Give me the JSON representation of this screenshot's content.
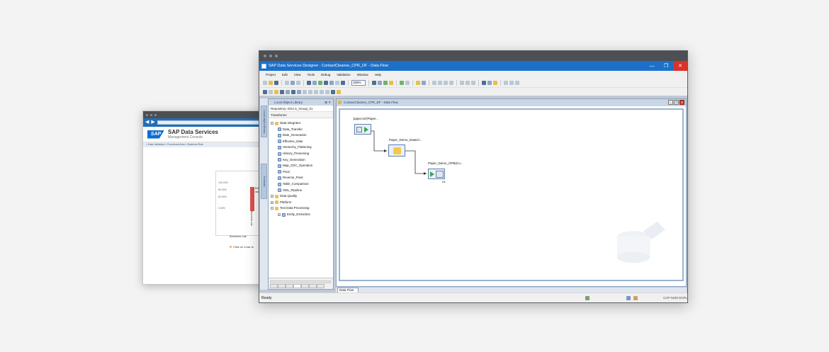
{
  "back_window": {
    "brand": "SAP",
    "product": "SAP Data Services",
    "subtitle": "Management Console",
    "breadcrumb": "» Data Validation » Functional Area » Business Rule",
    "chart": {
      "y_ticks": [
        "100.00%",
        "80.00%",
        "60.00%",
        "0.00%"
      ],
      "bar_label": "Ent. val.",
      "x_label": "Business rule"
    },
    "legend_line": "Business rule",
    "hint": "Click on a bar to"
  },
  "designer": {
    "title": "SAP Data Services Designer - ContactCleanse_CPR_DF - Data Flow",
    "menu": [
      "Project",
      "Edit",
      "View",
      "Tools",
      "Debug",
      "Validation",
      "Window",
      "Help"
    ],
    "zoom": "100%",
    "library": {
      "header": "Local Object Library",
      "repository": "Repository: DS4.X_Group_01",
      "tab": "Transforms",
      "vtabs": [
        "Local object library",
        "Formats"
      ],
      "tree": [
        {
          "label": "Data Integrator",
          "level": 0,
          "expander": "−",
          "icon": "folder"
        },
        {
          "label": "Data_Transfer",
          "level": 1
        },
        {
          "label": "Date_Generation",
          "level": 1
        },
        {
          "label": "Effective_Date",
          "level": 1
        },
        {
          "label": "Hierarchy_Flattening",
          "level": 1
        },
        {
          "label": "History_Preserving",
          "level": 1
        },
        {
          "label": "Key_Generation",
          "level": 1
        },
        {
          "label": "Map_CDC_Operation",
          "level": 1
        },
        {
          "label": "Pivot",
          "level": 1
        },
        {
          "label": "Reverse_Pivot",
          "level": 1
        },
        {
          "label": "Table_Comparison",
          "level": 1
        },
        {
          "label": "XML_Pipeline",
          "level": 1
        },
        {
          "label": "Data Quality",
          "level": 0,
          "expander": "+",
          "icon": "folder"
        },
        {
          "label": "Platform",
          "level": 0,
          "expander": "+",
          "icon": "folder"
        },
        {
          "label": "Text Data Processing",
          "level": 0,
          "expander": "−",
          "icon": "folder"
        },
        {
          "label": "Entity_Extraction",
          "level": 1,
          "expander": "+"
        }
      ]
    },
    "editor": {
      "tab_title": "ContactCleanse_CPR_DF - Data Flow",
      "objects": {
        "source": "'paper.txt'(Paper...",
        "transform": "Paper_Demo_DataCl...",
        "target": "Paper_Demo_OPB(Co...",
        "target_sub": "DL"
      },
      "bottom_tab": "Data Flow"
    },
    "status": {
      "left": "Ready",
      "right": "CAP  NUM  SCRL"
    }
  }
}
